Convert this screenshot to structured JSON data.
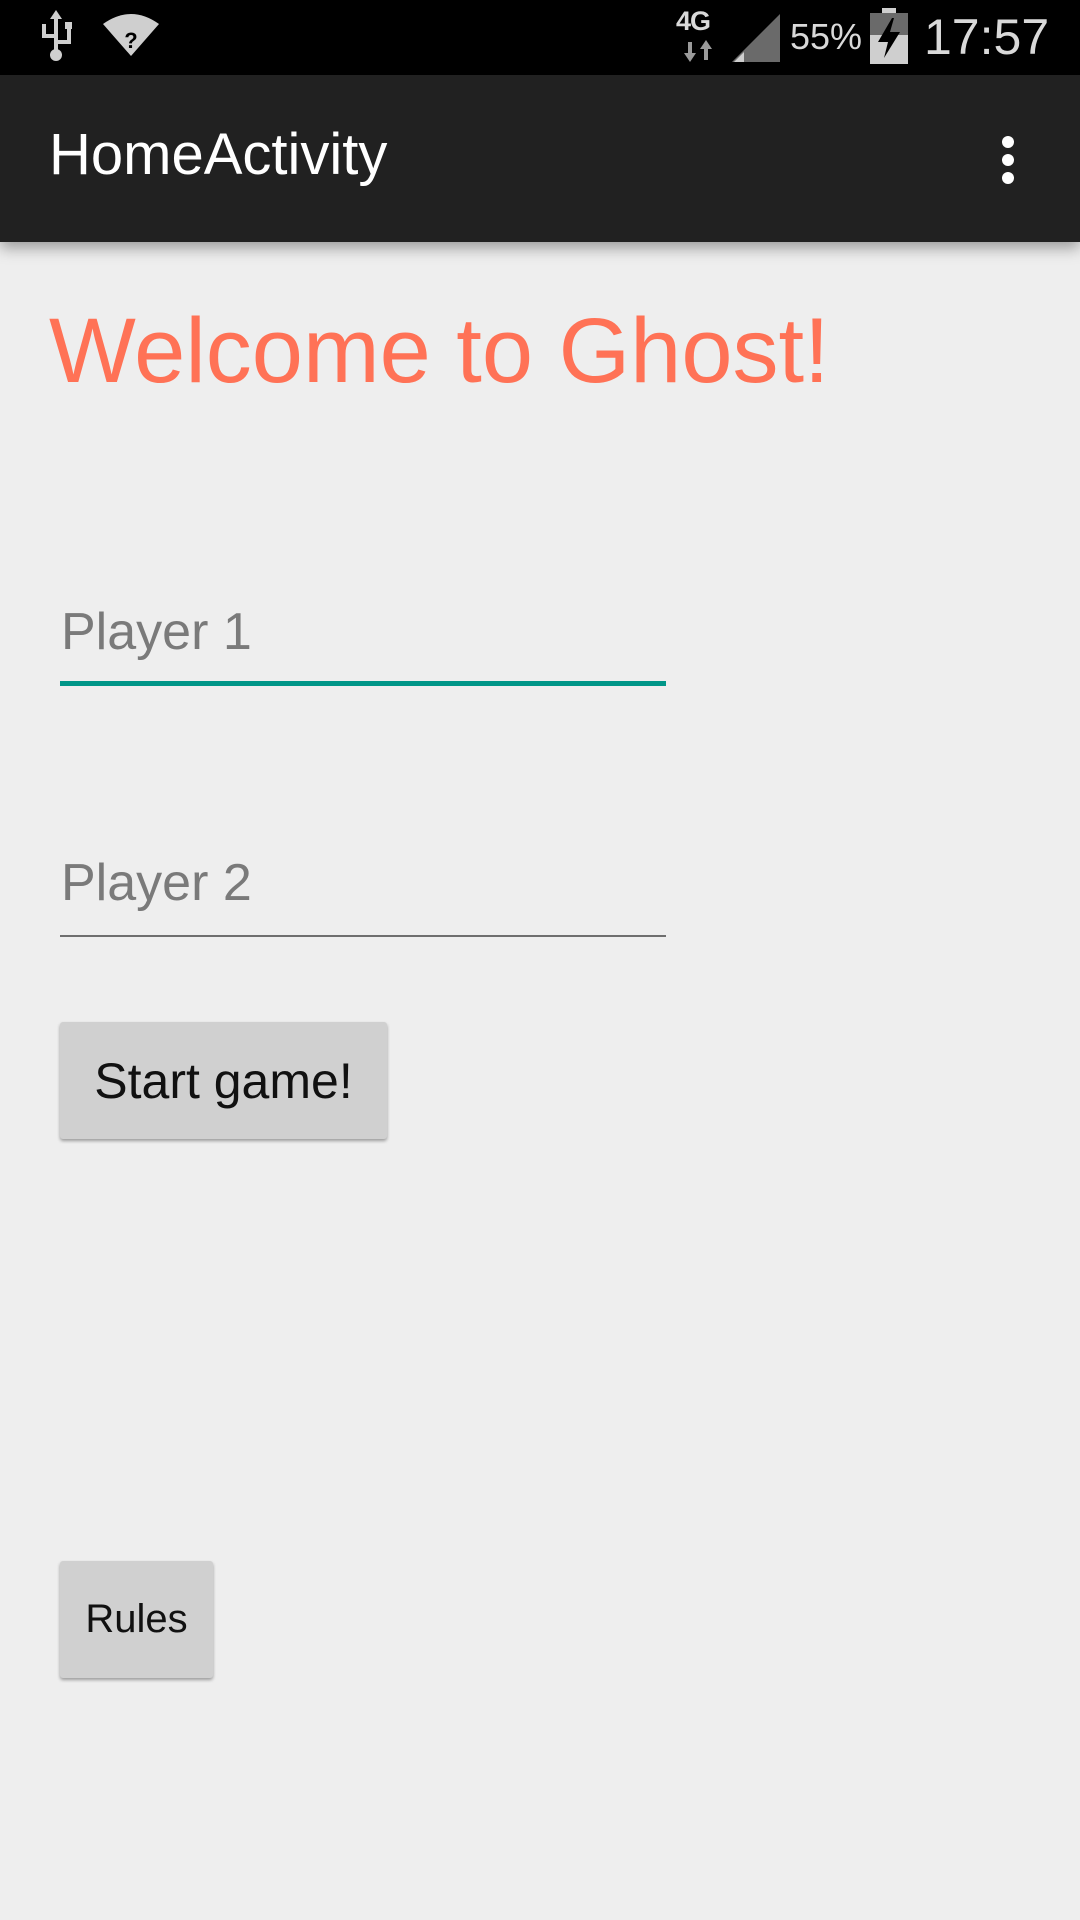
{
  "status_bar": {
    "network_type": "4G",
    "battery_percent": "55%",
    "time": "17:57",
    "icons": [
      "usb-icon",
      "wifi-icon",
      "data-arrows-icon",
      "signal-icon",
      "battery-charging-icon"
    ]
  },
  "action_bar": {
    "title": "HomeActivity",
    "overflow_icon": "more-vert-icon"
  },
  "main": {
    "welcome_text": "Welcome to Ghost!",
    "player1_placeholder": "Player 1",
    "player2_placeholder": "Player 2",
    "start_button_label": "Start game!",
    "rules_button_label": "Rules"
  },
  "colors": {
    "welcome": "#ff7256",
    "accent": "#009688",
    "action_bar": "#212121",
    "background": "#eeeeee"
  }
}
